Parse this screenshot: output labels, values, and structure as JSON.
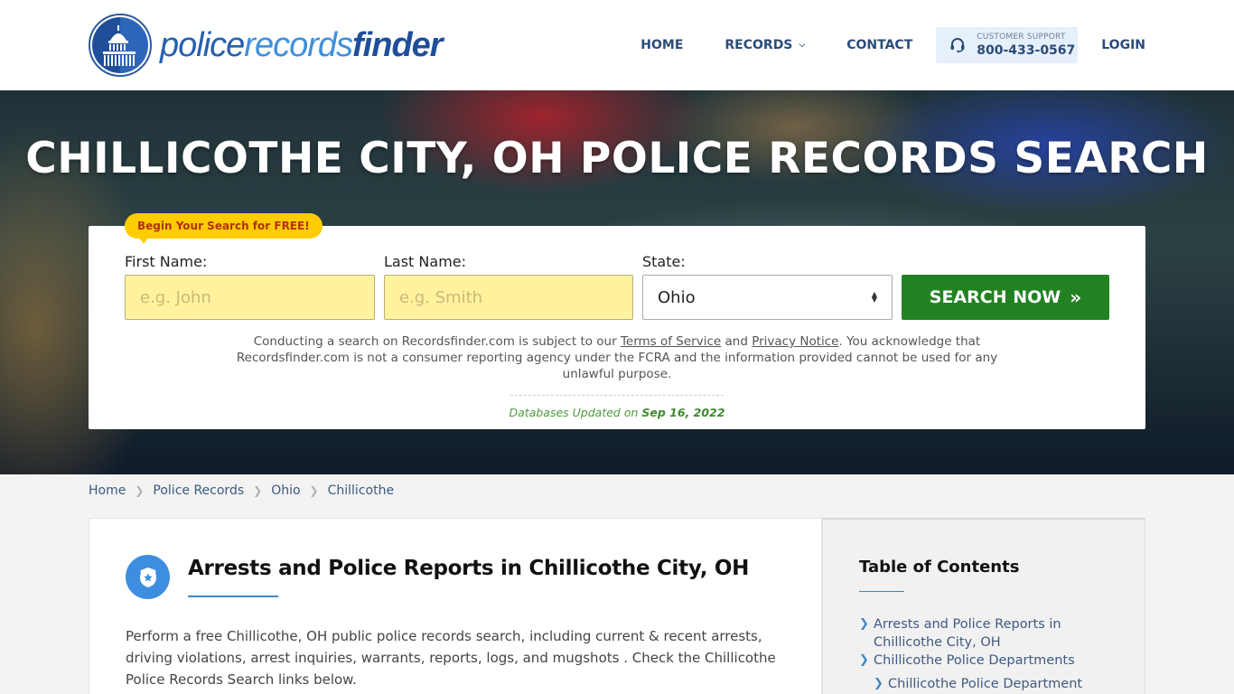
{
  "header": {
    "logo": {
      "part1": "police",
      "part2": "records",
      "part3": "finder"
    },
    "nav": [
      {
        "label": "HOME"
      },
      {
        "label": "RECORDS",
        "has_dropdown": true
      },
      {
        "label": "CONTACT"
      }
    ],
    "support": {
      "label": "CUSTOMER SUPPORT",
      "phone": "800-433-0567",
      "icon": "headset-icon"
    },
    "login_label": "LOGIN"
  },
  "hero": {
    "title": "CHILLICOTHE CITY, OH POLICE RECORDS SEARCH",
    "badge": "Begin Your Search for FREE!",
    "form": {
      "first_name_label": "First Name:",
      "first_name_placeholder": "e.g. John",
      "first_name_value": "",
      "last_name_label": "Last Name:",
      "last_name_placeholder": "e.g. Smith",
      "last_name_value": "",
      "state_label": "State:",
      "state_value": "Ohio",
      "search_button": "SEARCH NOW",
      "search_button_icon": "»"
    },
    "disclaimer": {
      "part1": "Conducting a search on Recordsfinder.com is subject to our ",
      "terms_link": "Terms of Service",
      "part2": " and ",
      "privacy_link": "Privacy Notice",
      "part3": ". You acknowledge that Recordsfinder.com is not a consumer reporting agency under the FCRA and the information provided cannot be used for any unlawful purpose."
    },
    "updated": {
      "label": "Databases Updated on ",
      "date": "Sep 16, 2022"
    }
  },
  "breadcrumb": [
    "Home",
    "Police Records",
    "Ohio",
    "Chillicothe"
  ],
  "article": {
    "title": "Arrests and Police Reports in Chillicothe City, OH",
    "icon": "police-badge-icon",
    "body": "Perform a free Chillicothe, OH public police records search, including current & recent arrests, driving violations, arrest inquiries, warrants, reports, logs, and mugshots . Check the Chillicothe Police Records Search links below."
  },
  "toc": {
    "title": "Table of Contents",
    "items": [
      {
        "label": "Arrests and Police Reports in Chillicothe City, OH",
        "level": 1
      },
      {
        "label": "Chillicothe Police Departments",
        "level": 1
      },
      {
        "label": "Chillicothe Police Department",
        "level": 2
      }
    ]
  },
  "colors": {
    "brand_blue": "#2660ad",
    "nav_text": "#2b4c78",
    "search_green": "#228222",
    "badge_yellow": "#ffcc00",
    "input_yellow": "#fff39e",
    "updated_green": "#4f9a3e",
    "accent_blue": "#3d8ee0"
  }
}
